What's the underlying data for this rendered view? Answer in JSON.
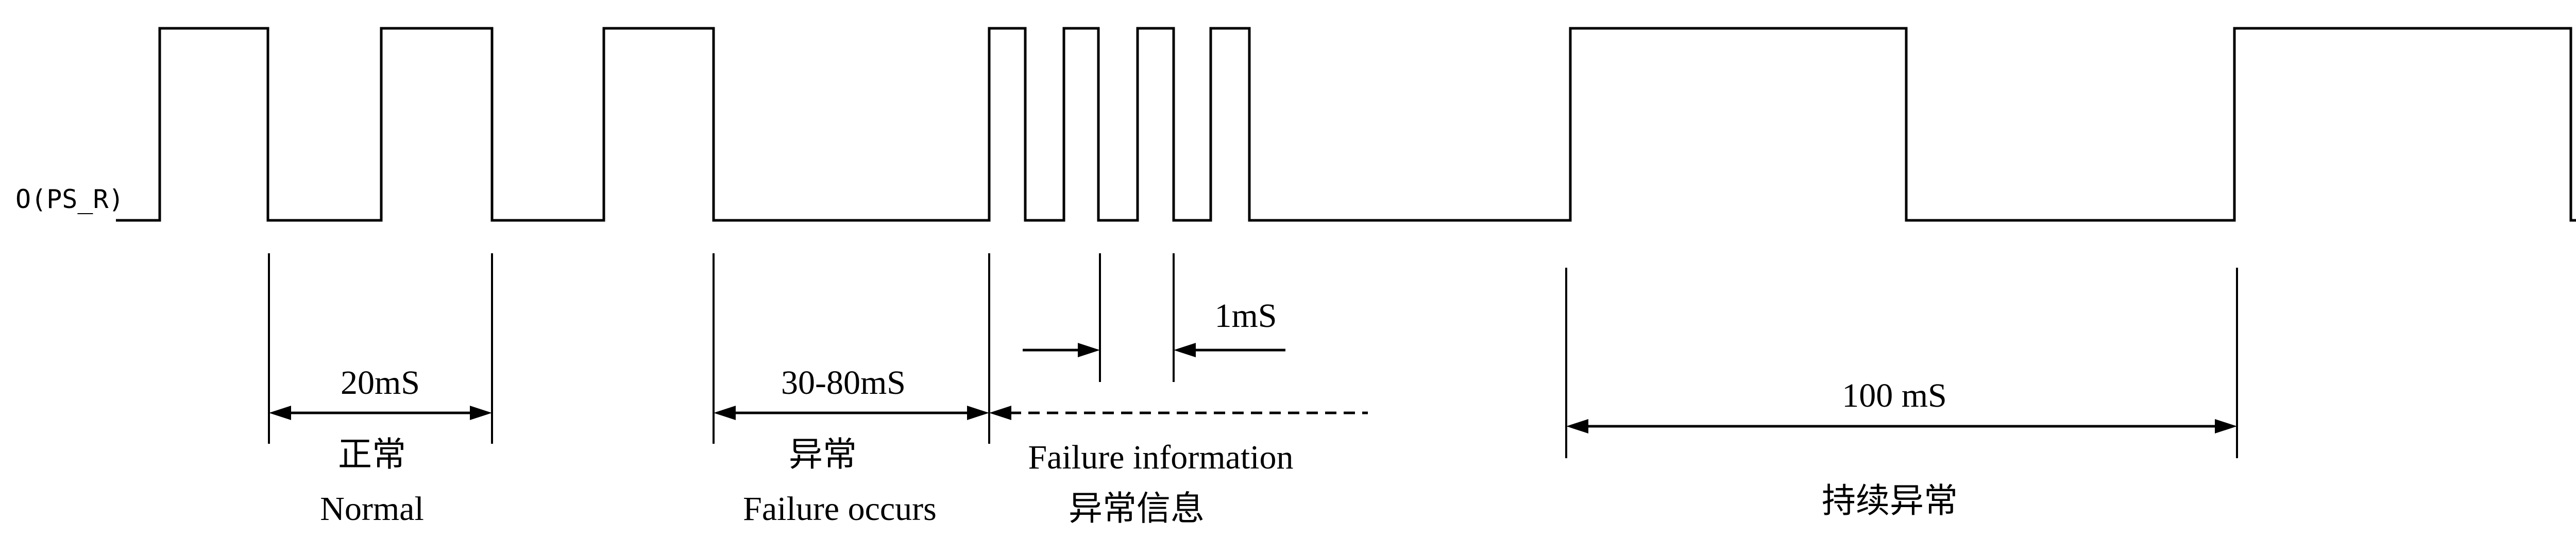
{
  "signal_label": "O(PS_R)",
  "intervals": {
    "normal": {
      "duration": "20mS",
      "label_cn": "正常",
      "label_en": "Normal"
    },
    "failure": {
      "duration": "30-80mS",
      "label_cn": "异常",
      "label_en": "Failure occurs"
    },
    "failure_info": {
      "duration": "1mS",
      "label_en": "Failure information",
      "label_cn": "异常信息"
    },
    "continuous": {
      "duration": "100 mS",
      "label_cn": "持续异常"
    }
  }
}
